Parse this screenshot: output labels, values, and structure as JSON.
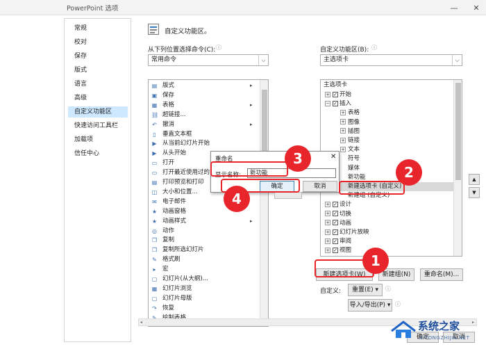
{
  "window": {
    "title": "PowerPoint 选项",
    "minimize": "—",
    "close": "✕"
  },
  "sidebar": {
    "items": [
      {
        "label": "常规"
      },
      {
        "label": "校对"
      },
      {
        "label": "保存"
      },
      {
        "label": "版式"
      },
      {
        "label": "语言"
      },
      {
        "label": "高级"
      },
      {
        "label": "自定义功能区",
        "selected": true
      },
      {
        "label": "快速访问工具栏"
      },
      {
        "label": "加载项"
      },
      {
        "label": "信任中心"
      }
    ]
  },
  "header": {
    "title": "自定义功能区。"
  },
  "left_panel": {
    "label": "从下列位置选择命令(C):",
    "combo_value": "常用命令",
    "commands": [
      {
        "label": "版式",
        "icon": "layout-icon",
        "submenu": true
      },
      {
        "label": "保存",
        "icon": "save-icon"
      },
      {
        "label": "表格",
        "icon": "table-icon",
        "submenu": true
      },
      {
        "label": "超链接...",
        "icon": "hyperlink-icon"
      },
      {
        "label": "撤消",
        "icon": "undo-icon",
        "submenu": true
      },
      {
        "label": "垂直文本框",
        "icon": "vertical-textbox-icon"
      },
      {
        "label": "从当前幻灯片开始",
        "icon": "slideshow-current-icon"
      },
      {
        "label": "从头开始",
        "icon": "slideshow-start-icon"
      },
      {
        "label": "打开",
        "icon": "open-icon"
      },
      {
        "label": "打开最近使用过的",
        "icon": "recent-icon"
      },
      {
        "label": "打印预览和打印",
        "icon": "print-icon"
      },
      {
        "label": "大小和位置...",
        "icon": "size-icon"
      },
      {
        "label": "电子邮件",
        "icon": "email-icon"
      },
      {
        "label": "动画窗格",
        "icon": "animation-pane-icon"
      },
      {
        "label": "动画样式",
        "icon": "animation-style-icon",
        "submenu": true
      },
      {
        "label": "动作",
        "icon": "action-icon"
      },
      {
        "label": "复制",
        "icon": "copy-icon"
      },
      {
        "label": "复制所选幻灯片",
        "icon": "duplicate-slide-icon"
      },
      {
        "label": "格式刷",
        "icon": "format-painter-icon"
      },
      {
        "label": "宏",
        "icon": "macro-icon"
      },
      {
        "label": "幻灯片(从大纲)...",
        "icon": "slide-outline-icon"
      },
      {
        "label": "幻灯片浏览",
        "icon": "slide-sorter-icon"
      },
      {
        "label": "幻灯片母版",
        "icon": "slide-master-icon"
      },
      {
        "label": "恢复",
        "icon": "redo-icon"
      },
      {
        "label": "绘制表格",
        "icon": "draw-table-icon"
      }
    ]
  },
  "right_panel": {
    "label": "自定义功能区(B):",
    "combo_value": "主选项卡",
    "tree_header": "主选项卡",
    "tree": [
      {
        "label": "开始",
        "expander": "⊞",
        "checked": true,
        "indent": 0
      },
      {
        "label": "插入",
        "expander": "⊟",
        "checked": true,
        "indent": 0
      },
      {
        "label": "表格",
        "expander": "⊞",
        "indent": 1
      },
      {
        "label": "图像",
        "expander": "⊞",
        "indent": 1
      },
      {
        "label": "插图",
        "expander": "⊞",
        "indent": 1
      },
      {
        "label": "链接",
        "expander": "⊞",
        "indent": 1
      },
      {
        "label": "文本",
        "expander": "⊞",
        "indent": 1
      },
      {
        "label": "符号",
        "expander": "",
        "indent": 1
      },
      {
        "label": "媒体",
        "expander": "",
        "indent": 1
      },
      {
        "label": "新功能",
        "expander": "",
        "indent": 1
      },
      {
        "label": "新建选项卡 (自定义)",
        "expander": "",
        "indent": 1,
        "selected": true
      },
      {
        "label": "新建组 (自定义)",
        "expander": "",
        "indent": 1
      },
      {
        "label": "设计",
        "expander": "⊞",
        "checked": true,
        "indent": 0
      },
      {
        "label": "切换",
        "expander": "⊞",
        "checked": true,
        "indent": 0
      },
      {
        "label": "动画",
        "expander": "⊞",
        "checked": true,
        "indent": 0
      },
      {
        "label": "幻灯片放映",
        "expander": "⊞",
        "checked": true,
        "indent": 0
      },
      {
        "label": "审阅",
        "expander": "⊞",
        "checked": true,
        "indent": 0
      },
      {
        "label": "视图",
        "expander": "⊞",
        "checked": true,
        "indent": 0
      }
    ],
    "buttons": {
      "new_tab": "新建选项卡(W)",
      "new_group": "新建组(N)",
      "rename": "重命名(M)..."
    },
    "customize_label": "自定义:",
    "reset_button": "重置(E) ▾",
    "import_export_button": "导入/导出(P) ▾",
    "move_up": "▲",
    "move_down": "▼"
  },
  "dialog": {
    "title": "重命名",
    "close": "✕",
    "field_label": "显示名称:",
    "field_value": "新功能",
    "ok": "确定",
    "cancel": "取消"
  },
  "callouts": [
    "1",
    "2",
    "3",
    "4"
  ],
  "footer": {
    "ok": "确定",
    "cancel": "取消"
  },
  "watermark": {
    "name": "系统之家",
    "url": "XITONGZHIJIA.NET"
  },
  "colors": {
    "callout": "#e8252b",
    "selected": "#cde8ff"
  }
}
